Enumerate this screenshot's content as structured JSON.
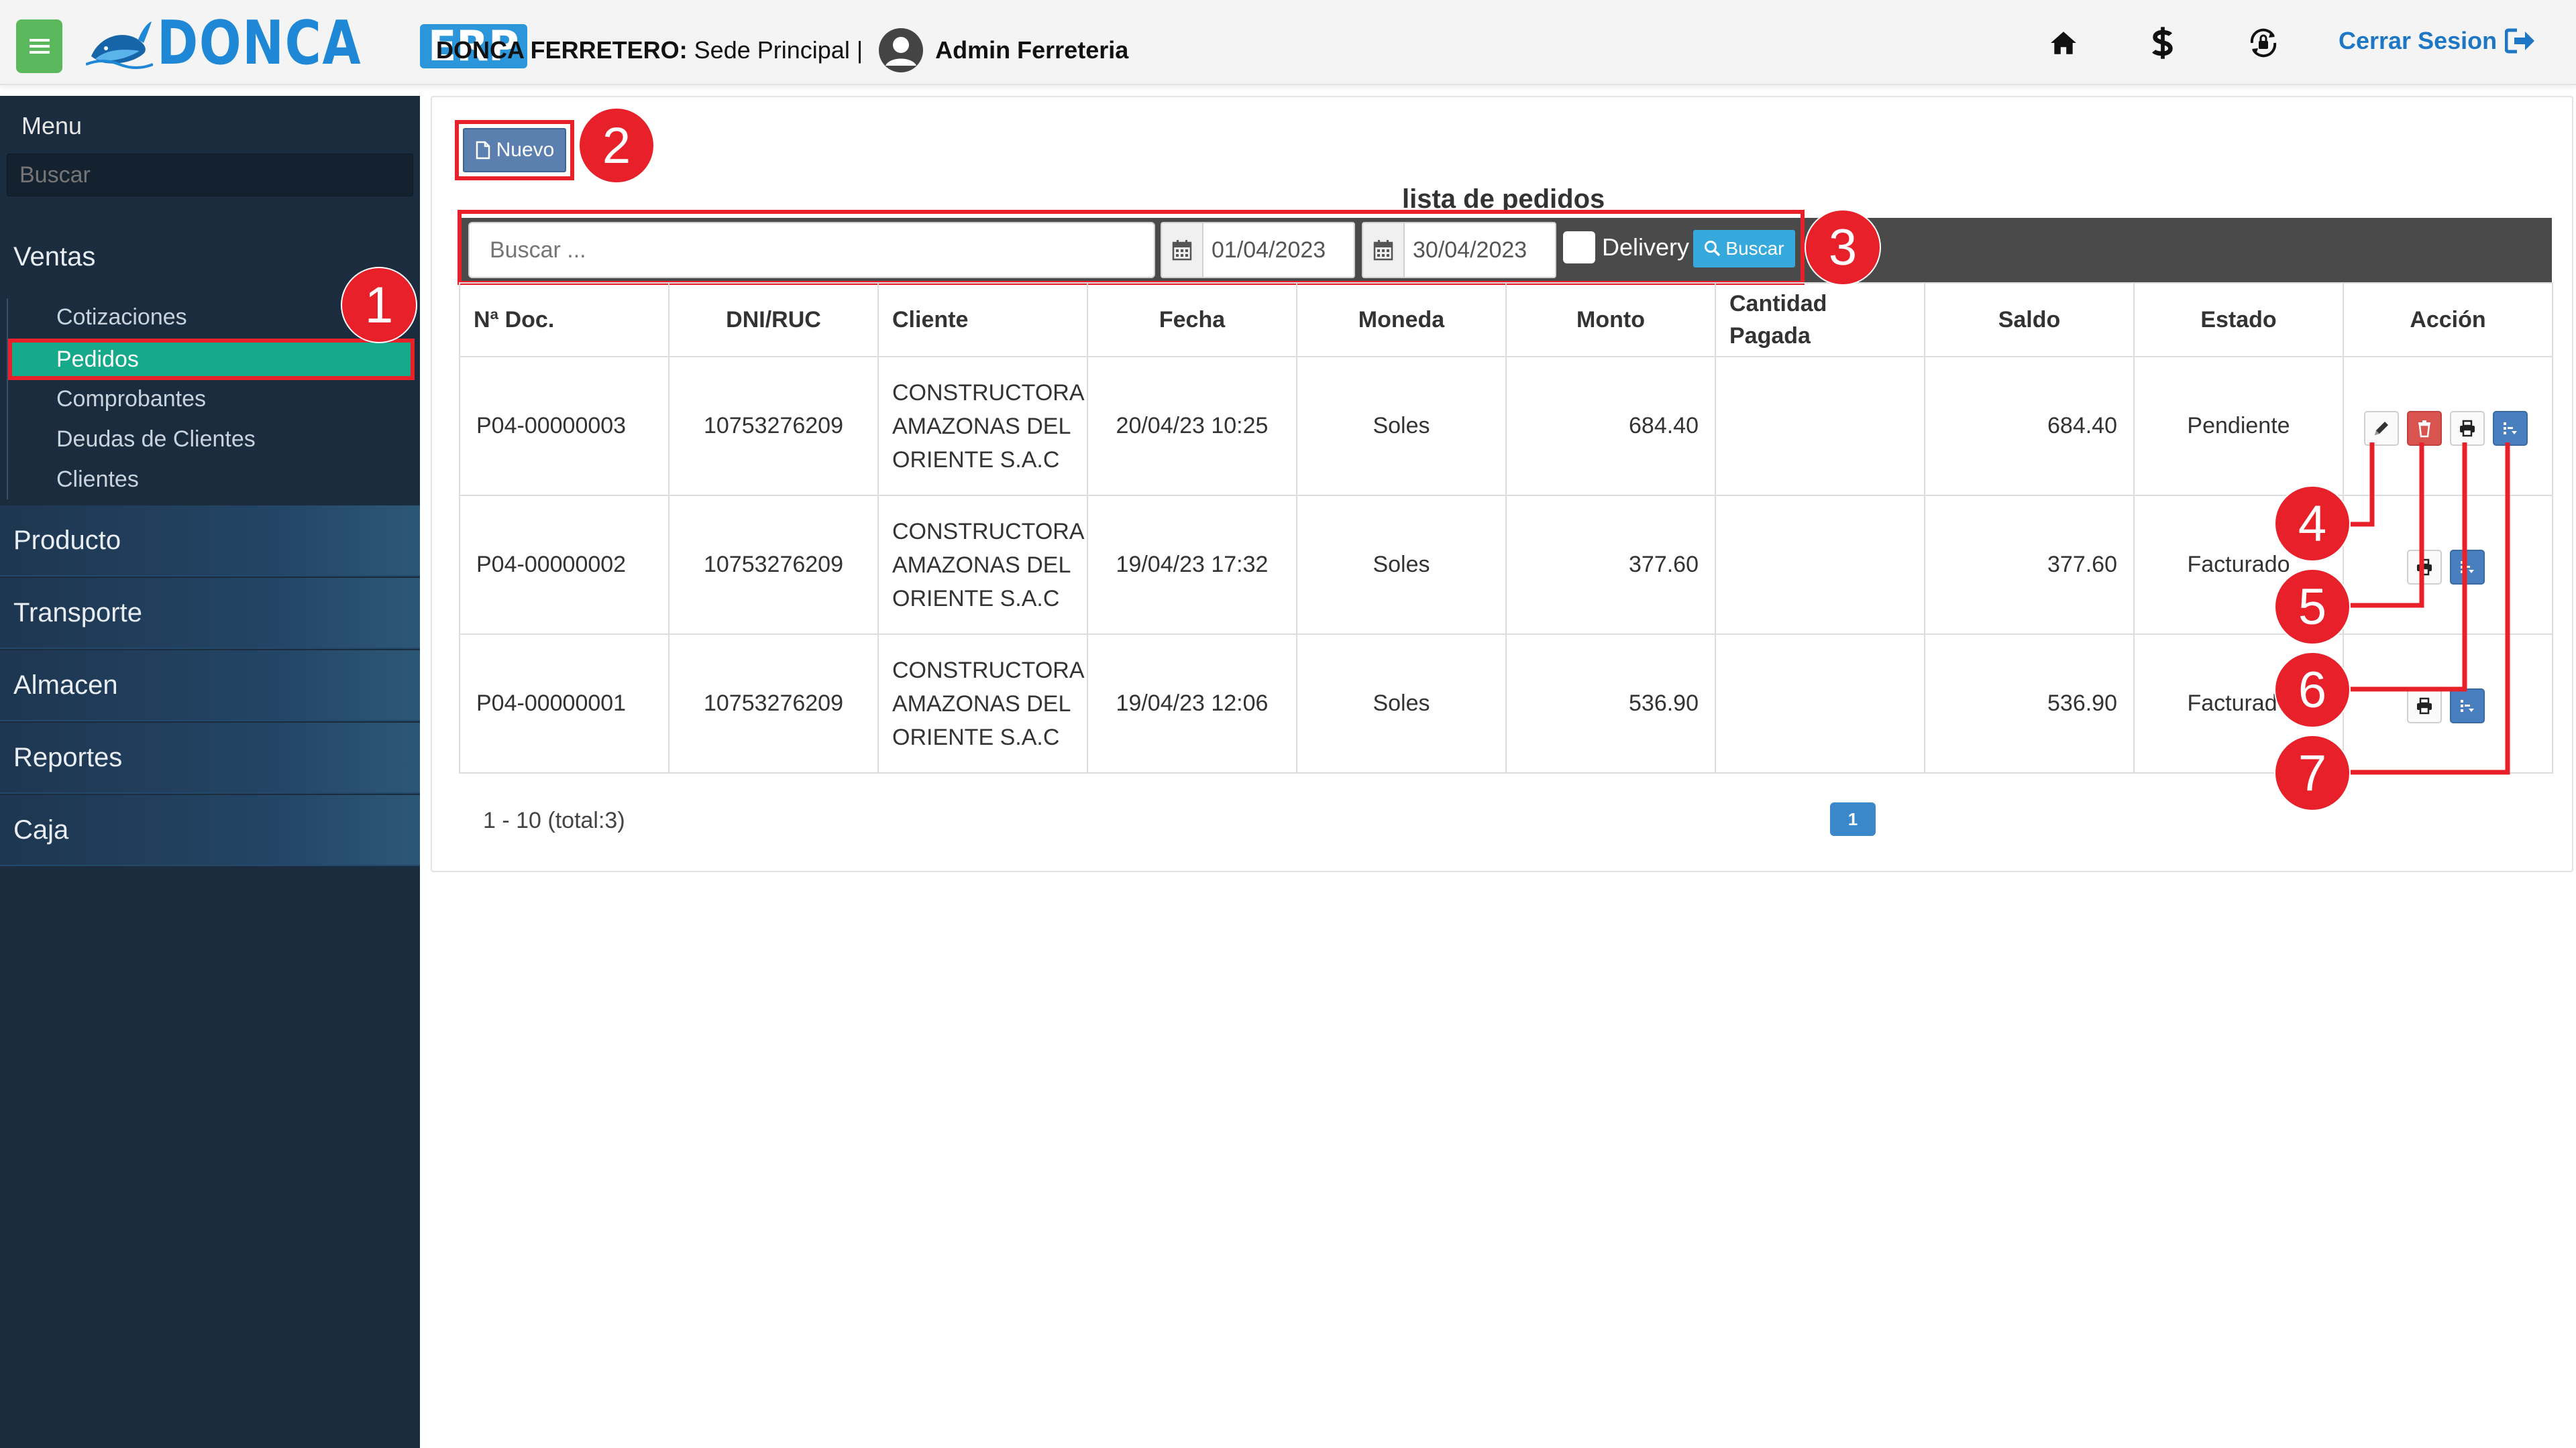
{
  "header": {
    "brand": "DONCA",
    "brand_badge": "ERP",
    "company_name": "DONCA FERRETERO:",
    "site": " Sede Principal | ",
    "user": "Admin Ferreteria",
    "logout_label": "Cerrar Sesion",
    "icons": [
      "menu-icon",
      "home-icon",
      "dollar-icon",
      "lock-refresh-icon",
      "sign-out-icon"
    ]
  },
  "sidebar": {
    "title": "Menu",
    "search_placeholder": "Buscar",
    "sections": [
      {
        "label": "Ventas"
      },
      {
        "label": "Producto"
      },
      {
        "label": "Transporte"
      },
      {
        "label": "Almacen"
      },
      {
        "label": "Reportes"
      },
      {
        "label": "Caja"
      }
    ],
    "ventas_items": [
      {
        "label": "Cotizaciones"
      },
      {
        "label": "Pedidos",
        "active": true
      },
      {
        "label": "Comprobantes"
      },
      {
        "label": "Deudas de Clientes"
      },
      {
        "label": "Clientes"
      }
    ]
  },
  "main": {
    "new_button": "Nuevo",
    "title": "lista de pedidos",
    "filters": {
      "search_placeholder": "Buscar ...",
      "date_from": "01/04/2023",
      "date_to": "30/04/2023",
      "delivery_label": "Delivery",
      "search_button": "Buscar"
    },
    "table": {
      "columns": [
        "Nª Doc.",
        "DNI/RUC",
        "Cliente",
        "Fecha",
        "Moneda",
        "Monto",
        "Cantidad Pagada",
        "Saldo",
        "Estado",
        "Acción"
      ],
      "rows": [
        {
          "doc": "P04-00000003",
          "ruc": "10753276209",
          "client": "CONSTRUCTORA AMAZONAS DEL ORIENTE S.A.C",
          "date": "20/04/23 10:25",
          "currency": "Soles",
          "amount": "684.40",
          "paid": "",
          "balance": "684.40",
          "status": "Pendiente"
        },
        {
          "doc": "P04-00000002",
          "ruc": "10753276209",
          "client": "CONSTRUCTORA AMAZONAS DEL ORIENTE S.A.C",
          "date": "19/04/23 17:32",
          "currency": "Soles",
          "amount": "377.60",
          "paid": "",
          "balance": "377.60",
          "status": "Facturado"
        },
        {
          "doc": "P04-00000001",
          "ruc": "10753276209",
          "client": "CONSTRUCTORA AMAZONAS DEL ORIENTE S.A.C",
          "date": "19/04/23 12:06",
          "currency": "Soles",
          "amount": "536.90",
          "paid": "",
          "balance": "536.90",
          "status": "Facturado"
        }
      ]
    },
    "pagination": {
      "info": "1 - 10 (total:3)",
      "current_page": "1"
    }
  },
  "annotations": [
    "1",
    "2",
    "3",
    "4",
    "5",
    "6",
    "7"
  ],
  "colors": {
    "sidebar_bg": "#1b2c3e",
    "active_item": "#16a98a",
    "annotation_red": "#e8202a",
    "primary_blue": "#1e88d6",
    "filter_bar": "#4a4a4a"
  }
}
